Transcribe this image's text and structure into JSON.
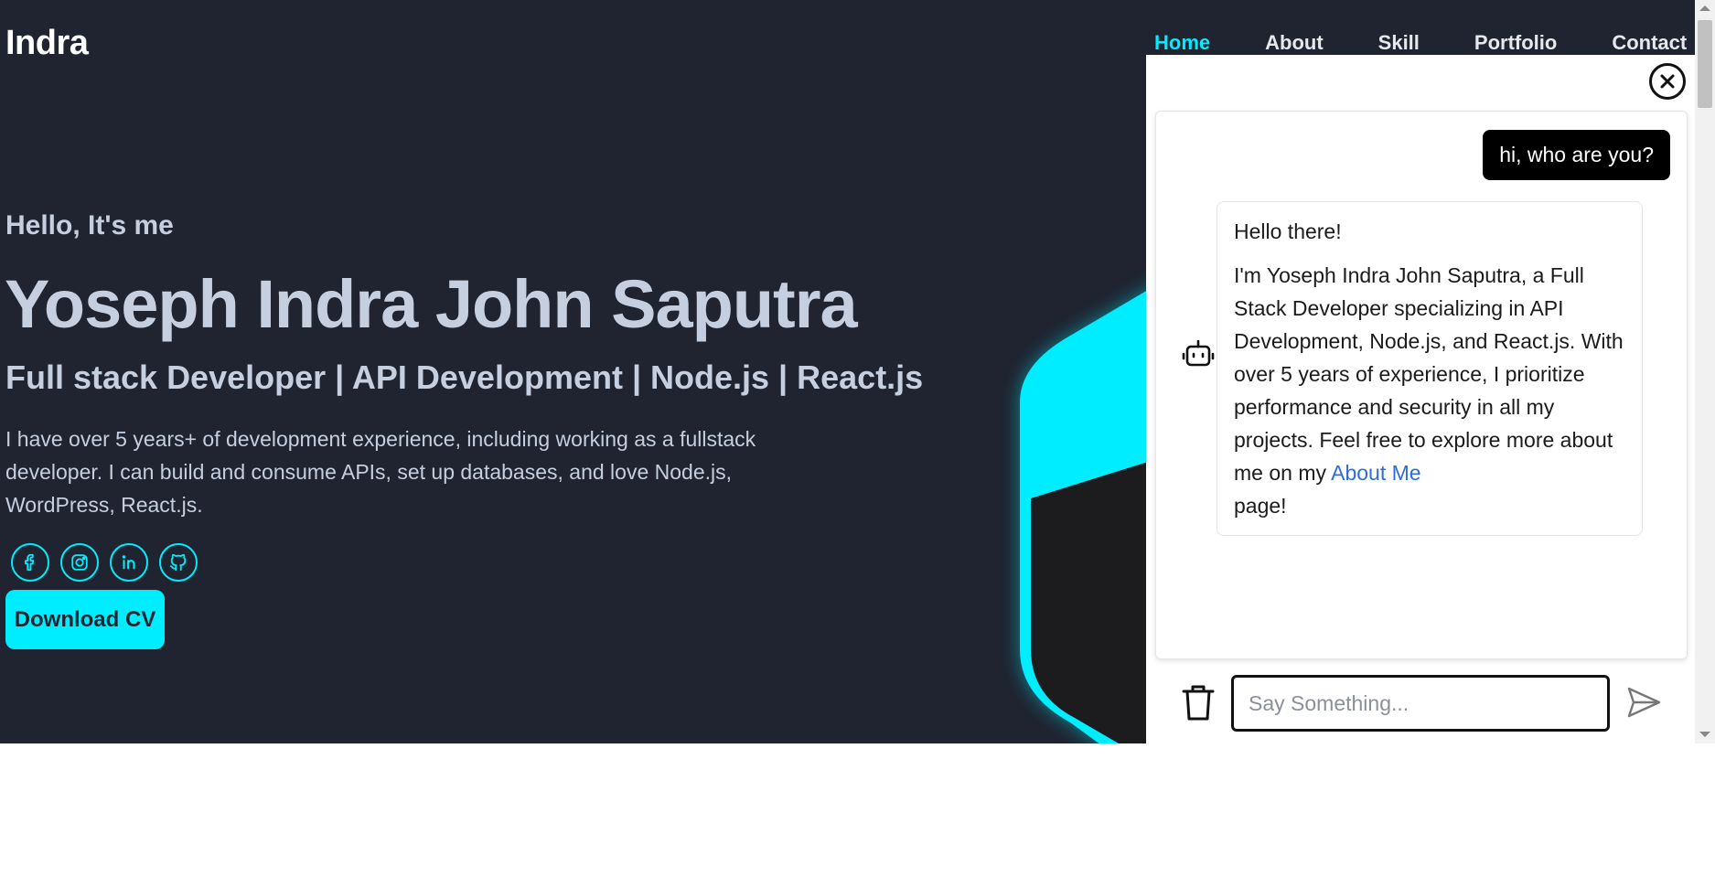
{
  "brand": {
    "logo": "Indra"
  },
  "nav": {
    "items": [
      {
        "label": "Home",
        "active": true
      },
      {
        "label": "About",
        "active": false
      },
      {
        "label": "Skill",
        "active": false
      },
      {
        "label": "Portfolio",
        "active": false
      },
      {
        "label": "Contact",
        "active": false
      }
    ]
  },
  "hero": {
    "greeting": "Hello, It's me",
    "name": "Yoseph Indra John Saputra",
    "role": "Full stack Developer | API Development | Node.js | React.js",
    "description": "I have over 5 years+ of development experience, including working as a fullstack developer. I can build and consume APIs, set up databases, and love Node.js, WordPress, React.js.",
    "socials": [
      "facebook-icon",
      "instagram-icon",
      "linkedin-icon",
      "github-icon"
    ],
    "cv_button": "Download CV"
  },
  "chat": {
    "user_message": "hi, who are you?",
    "bot_greeting": "Hello there!",
    "bot_body": "I'm Yoseph Indra John Saputra, a Full Stack Developer specializing in API Development, Node.js, and React.js. With over 5 years of experience, I prioritize performance and security in all my projects. Feel free to explore more about me on my",
    "bot_link": "About Me",
    "bot_tail": "page!",
    "input_placeholder": "Say Something...",
    "input_value": ""
  },
  "colors": {
    "accent": "#00ecff",
    "background": "#1f2430",
    "text": "#c6cfdf",
    "link": "#2d6be0"
  }
}
